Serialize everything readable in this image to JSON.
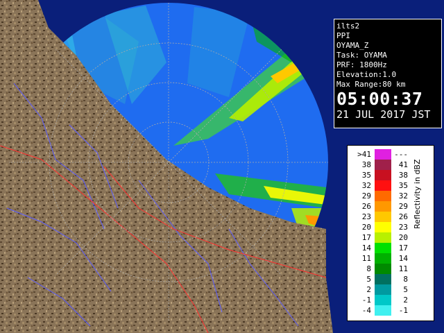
{
  "info": {
    "lines": [
      "ilts2",
      "PPI",
      "OYAMA_Z",
      "Task: OYAMA",
      "PRF: 1800Hz",
      "Elevation:1.0",
      "Max Range:80 km"
    ],
    "time": "05:00:37",
    "date": "21 JUL 2017 JST"
  },
  "legend": {
    "title": "Reflectivity in dBZ",
    "rows": [
      {
        "left": ">41",
        "right": "---",
        "color": "#e020e0"
      },
      {
        "left": "38",
        "right": "41",
        "color": "#a0204a"
      },
      {
        "left": "35",
        "right": "38",
        "color": "#c81020"
      },
      {
        "left": "32",
        "right": "35",
        "color": "#ff1010"
      },
      {
        "left": "29",
        "right": "32",
        "color": "#ff6a00"
      },
      {
        "left": "26",
        "right": "29",
        "color": "#ff9800"
      },
      {
        "left": "23",
        "right": "26",
        "color": "#ffc800"
      },
      {
        "left": "20",
        "right": "23",
        "color": "#ffff00"
      },
      {
        "left": "17",
        "right": "20",
        "color": "#b8f000"
      },
      {
        "left": "14",
        "right": "17",
        "color": "#00e000"
      },
      {
        "left": "11",
        "right": "14",
        "color": "#00b000"
      },
      {
        "left": "8",
        "right": "11",
        "color": "#008a00"
      },
      {
        "left": "5",
        "right": "8",
        "color": "#007060"
      },
      {
        "left": "2",
        "right": "5",
        "color": "#009aa0"
      },
      {
        "left": "-1",
        "right": "2",
        "color": "#00c8c8"
      },
      {
        "left": "-4",
        "right": "-1",
        "color": "#40f0f0"
      }
    ]
  },
  "colors": {
    "sea": "#1f6cf0",
    "sea_dark": "#0a1f7a",
    "land": "#8a7458",
    "river": "#5a5cff",
    "border": "#ff3030"
  }
}
